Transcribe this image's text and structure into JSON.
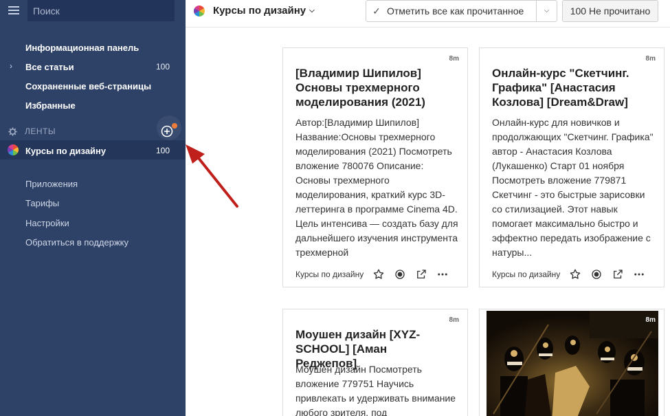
{
  "sidebar": {
    "search_placeholder": "Поиск",
    "nav": [
      {
        "label": "Информационная панель",
        "count": ""
      },
      {
        "label": "Все статьи",
        "count": "100"
      },
      {
        "label": "Сохраненные веб-страницы",
        "count": ""
      },
      {
        "label": "Избранные",
        "count": ""
      }
    ],
    "feeds_header": "ЛЕНТЫ",
    "active_feed": {
      "label": "Курсы по дизайну",
      "count": "100"
    },
    "links": [
      "Приложения",
      "Тарифы",
      "Настройки",
      "Обратиться в поддержку"
    ]
  },
  "topbar": {
    "feed_title": "Курсы по дизайну",
    "mark_all_read": "Отметить все как прочитанное",
    "unread_button": "100 Не прочитано"
  },
  "cards": [
    {
      "time": "8m",
      "title": "[Владимир Шипилов] Основы трехмерного моделирования (2021)",
      "text": "Автор:[Владимир Шипилов] Название:Основы трехмерного моделирования (2021) Посмотреть вложение 780076 Описание: Основы трехмерного моделирования, краткий курс 3D-леттеринга в программе Cinema 4D. Цель интенсива — создать базу для дальнейшего изучения инструмента трехмерной",
      "source": "Курсы по дизайну"
    },
    {
      "time": "8m",
      "title": "Онлайн-курс \"Скетчинг. Графика\" [Анастасия Козлова] [Dream&Draw]",
      "text": "Онлайн-курс для новичков и продолжающих \"Скетчинг. Графика\" автор - Анастасия Козлова (Лукашенко) Старт 01 ноября Посмотреть вложение 779871 Скетчинг - это быстрые зарисовки со стилизацией. Этот навык помогает максимально быстро и эффектно передать изображение с натуры...",
      "source": "Курсы по дизайну"
    },
    {
      "time": "8m",
      "title": "Моушен дизайн [XYZ-SCHOOL] [Аман Реджепов]",
      "text": "Моушен дизайн Посмотреть вложение 779751 Научись привлекать и удерживать внимание любого зрителя, под",
      "source": ""
    }
  ],
  "image_card": {
    "time": "8m"
  },
  "colors": {
    "sidebar_bg": "#2e4268",
    "accent_dot": "#ef7e3d",
    "arrow": "#c0201c"
  }
}
